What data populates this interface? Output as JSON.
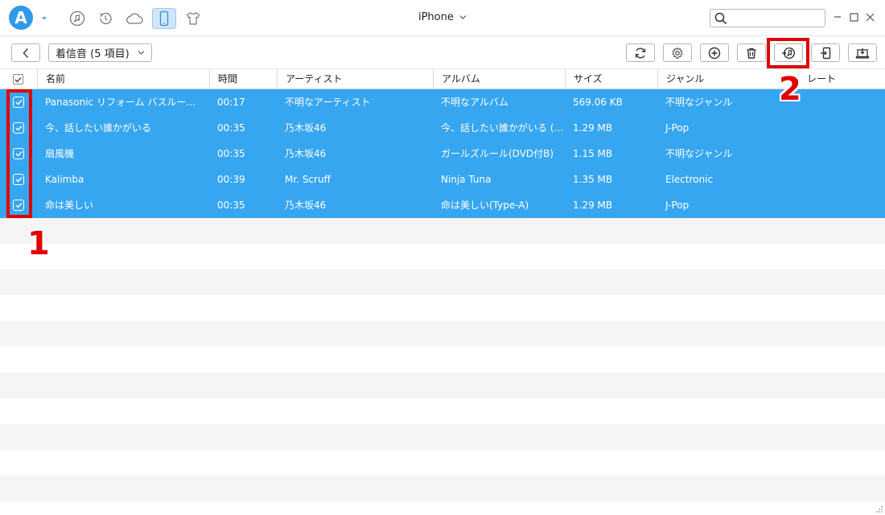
{
  "app": {
    "logo_letter": "A",
    "device_title": "iPhone",
    "accent_color": "#37a6f1",
    "annotation_color": "#e00000",
    "nav_icons": [
      "music-note-icon",
      "history-icon",
      "cloud-icon",
      "phone-icon",
      "tshirt-icon"
    ],
    "search": {
      "placeholder": "",
      "value": ""
    }
  },
  "toolbar": {
    "category_label": "着信音 (5 項目)",
    "actions": [
      "refresh-icon",
      "settings-icon",
      "add-icon",
      "delete-icon",
      "to-itunes-icon",
      "export-to-device-icon",
      "to-computer-icon"
    ]
  },
  "table": {
    "columns": [
      "名前",
      "時間",
      "アーティスト",
      "アルバム",
      "サイズ",
      "ジャンル",
      "レート"
    ],
    "rows": [
      {
        "name": "Panasonic リフォーム バスルーム編 C...",
        "time": "00:17",
        "artist": "不明なアーティスト",
        "album": "不明なアルバム",
        "size": "569.06 KB",
        "genre": "不明なジャンル",
        "checked": true
      },
      {
        "name": "今、話したい誰かがいる",
        "time": "00:35",
        "artist": "乃木坂46",
        "album": "今、話したい誰かがいる (Sp...",
        "size": "1.29 MB",
        "genre": "J-Pop",
        "checked": true
      },
      {
        "name": "扇風機",
        "time": "00:35",
        "artist": "乃木坂46",
        "album": "ガールズルール(DVD付B)",
        "size": "1.15 MB",
        "genre": "不明なジャンル",
        "checked": true
      },
      {
        "name": "Kalimba",
        "time": "00:39",
        "artist": "Mr. Scruff",
        "album": "Ninja Tuna",
        "size": "1.35 MB",
        "genre": "Electronic",
        "checked": true
      },
      {
        "name": "命は美しい",
        "time": "00:35",
        "artist": "乃木坂46",
        "album": "命は美しい(Type-A)",
        "size": "1.29 MB",
        "genre": "J-Pop",
        "checked": true
      }
    ]
  },
  "annotations": {
    "step1": "1",
    "step2": "2"
  }
}
